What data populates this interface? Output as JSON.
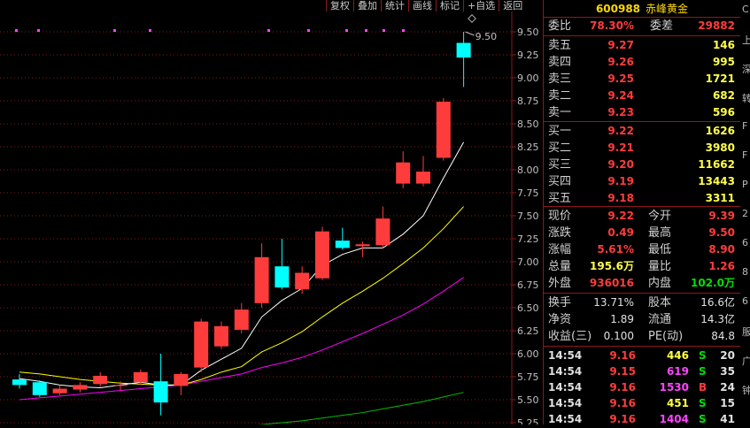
{
  "toolbar": [
    "复权",
    "叠加",
    "统计",
    "画线",
    "标记",
    "+自选",
    "返回"
  ],
  "colors": {
    "up": "#ff3c3c",
    "down": "#00ffff",
    "ma5": "#ffffff",
    "ma10": "#ffff00",
    "ma20": "#ff00ff",
    "ma60": "#00c000",
    "grid": "#8a1a1a"
  },
  "chart": {
    "y_ticks": [
      "9.50",
      "9.25",
      "9.00",
      "8.75",
      "8.50",
      "8.25",
      "8.00",
      "7.75",
      "7.50",
      "7.25",
      "7.00",
      "6.75",
      "6.50",
      "6.25",
      "6.00",
      "5.75",
      "5.50",
      "5.25"
    ],
    "high_label": "9.50",
    "candles": [
      {
        "o": 5.72,
        "c": 5.66,
        "h": 5.78,
        "l": 5.62
      },
      {
        "o": 5.69,
        "c": 5.55,
        "h": 5.71,
        "l": 5.53
      },
      {
        "o": 5.57,
        "c": 5.62,
        "h": 5.66,
        "l": 5.55
      },
      {
        "o": 5.61,
        "c": 5.66,
        "h": 5.69,
        "l": 5.58
      },
      {
        "o": 5.67,
        "c": 5.76,
        "h": 5.8,
        "l": 5.64
      },
      {
        "o": 5.65,
        "c": 5.66,
        "h": 5.7,
        "l": 5.6
      },
      {
        "o": 5.69,
        "c": 5.8,
        "h": 5.83,
        "l": 5.66
      },
      {
        "o": 5.7,
        "c": 5.47,
        "h": 6.0,
        "l": 5.33
      },
      {
        "o": 5.65,
        "c": 5.78,
        "h": 5.8,
        "l": 5.55
      },
      {
        "o": 5.85,
        "c": 6.35,
        "h": 6.38,
        "l": 5.8
      },
      {
        "o": 6.08,
        "c": 6.3,
        "h": 6.35,
        "l": 6.05
      },
      {
        "o": 6.26,
        "c": 6.48,
        "h": 6.55,
        "l": 6.22
      },
      {
        "o": 6.55,
        "c": 7.05,
        "h": 7.2,
        "l": 6.5
      },
      {
        "o": 6.95,
        "c": 6.72,
        "h": 7.25,
        "l": 6.7
      },
      {
        "o": 6.7,
        "c": 6.88,
        "h": 6.95,
        "l": 6.65
      },
      {
        "o": 6.82,
        "c": 7.33,
        "h": 7.38,
        "l": 6.8
      },
      {
        "o": 7.23,
        "c": 7.15,
        "h": 7.37,
        "l": 7.13
      },
      {
        "o": 7.17,
        "c": 7.19,
        "h": 7.22,
        "l": 7.05
      },
      {
        "o": 7.18,
        "c": 7.47,
        "h": 7.6,
        "l": 7.15
      },
      {
        "o": 7.85,
        "c": 8.08,
        "h": 8.2,
        "l": 7.8
      },
      {
        "o": 7.85,
        "c": 7.98,
        "h": 8.15,
        "l": 7.82
      },
      {
        "o": 8.13,
        "c": 8.74,
        "h": 8.78,
        "l": 8.1
      },
      {
        "o": 9.38,
        "c": 9.22,
        "h": 9.5,
        "l": 8.9
      }
    ],
    "ma5": [
      5.73,
      5.7,
      5.66,
      5.64,
      5.63,
      5.66,
      5.69,
      5.66,
      5.66,
      5.82,
      5.94,
      6.06,
      6.4,
      6.58,
      6.71,
      6.96,
      7.08,
      7.15,
      7.15,
      7.3,
      7.5,
      7.91,
      8.3
    ],
    "ma10": [
      5.8,
      5.78,
      5.75,
      5.72,
      5.7,
      5.68,
      5.67,
      5.66,
      5.66,
      5.72,
      5.8,
      5.86,
      6.02,
      6.12,
      6.24,
      6.4,
      6.55,
      6.68,
      6.82,
      6.98,
      7.15,
      7.36,
      7.6
    ],
    "ma20": [
      5.5,
      5.52,
      5.54,
      5.56,
      5.58,
      5.6,
      5.62,
      5.64,
      5.66,
      5.7,
      5.74,
      5.78,
      5.85,
      5.9,
      5.96,
      6.04,
      6.13,
      6.22,
      6.32,
      6.42,
      6.54,
      6.68,
      6.83
    ],
    "ma60": [
      5.1,
      5.11,
      5.12,
      5.13,
      5.14,
      5.15,
      5.16,
      5.17,
      5.18,
      5.19,
      5.2,
      5.21,
      5.23,
      5.25,
      5.27,
      5.3,
      5.33,
      5.36,
      5.4,
      5.44,
      5.48,
      5.53,
      5.58
    ]
  },
  "quote": {
    "code": "600988",
    "name": "赤峰黄金",
    "weibi_label": "委比",
    "weibi": "78.30%",
    "weicha_label": "委差",
    "weicha": "29882",
    "asks": [
      {
        "label": "卖五",
        "price": "9.27",
        "vol": "146"
      },
      {
        "label": "卖四",
        "price": "9.26",
        "vol": "995"
      },
      {
        "label": "卖三",
        "price": "9.25",
        "vol": "1721"
      },
      {
        "label": "卖二",
        "price": "9.24",
        "vol": "682"
      },
      {
        "label": "卖一",
        "price": "9.23",
        "vol": "596"
      }
    ],
    "bids": [
      {
        "label": "买一",
        "price": "9.22",
        "vol": "1626"
      },
      {
        "label": "买二",
        "price": "9.21",
        "vol": "3980"
      },
      {
        "label": "买三",
        "price": "9.20",
        "vol": "11662"
      },
      {
        "label": "买四",
        "price": "9.19",
        "vol": "13443"
      },
      {
        "label": "买五",
        "price": "9.18",
        "vol": "3311"
      }
    ],
    "stats": [
      {
        "l1": "现价",
        "v1": "9.22",
        "c1": "red",
        "l2": "今开",
        "v2": "9.39",
        "c2": "red"
      },
      {
        "l1": "涨跌",
        "v1": "0.49",
        "c1": "red",
        "l2": "最高",
        "v2": "9.50",
        "c2": "red"
      },
      {
        "l1": "涨幅",
        "v1": "5.61%",
        "c1": "red",
        "l2": "最低",
        "v2": "8.90",
        "c2": "red"
      },
      {
        "l1": "总量",
        "v1": "195.6万",
        "c1": "yel",
        "l2": "量比",
        "v2": "1.26",
        "c2": "red"
      },
      {
        "l1": "外盘",
        "v1": "936016",
        "c1": "red",
        "l2": "内盘",
        "v2": "102.0万",
        "c2": "grn"
      }
    ],
    "stats2": [
      {
        "l1": "换手",
        "v1": "13.71%",
        "l2": "股本",
        "v2": "16.6亿"
      },
      {
        "l1": "净资",
        "v1": "1.89",
        "l2": "流通",
        "v2": "14.3亿"
      },
      {
        "l1": "收益(三)",
        "v1": "0.100",
        "l2": "PE(动)",
        "v2": "84.8"
      }
    ],
    "ticks": [
      {
        "time": "14:54",
        "price": "9.16",
        "vol": "446",
        "vc": "yel",
        "bs": "S",
        "n": "20"
      },
      {
        "time": "14:54",
        "price": "9.15",
        "vol": "619",
        "vc": "mag",
        "bs": "S",
        "n": "35"
      },
      {
        "time": "14:54",
        "price": "9.16",
        "vol": "1530",
        "vc": "mag",
        "bs": "B",
        "n": "24"
      },
      {
        "time": "14:54",
        "price": "9.16",
        "vol": "451",
        "vc": "yel",
        "bs": "S",
        "n": "15"
      },
      {
        "time": "14:54",
        "price": "9.16",
        "vol": "1404",
        "vc": "mag",
        "bs": "S",
        "n": "41"
      }
    ]
  },
  "right_strip_chars": [
    "C",
    "上",
    "深",
    "转",
    "F",
    "F",
    "P",
    "2",
    "6",
    "8",
    "6",
    "服",
    "广",
    "钟"
  ]
}
